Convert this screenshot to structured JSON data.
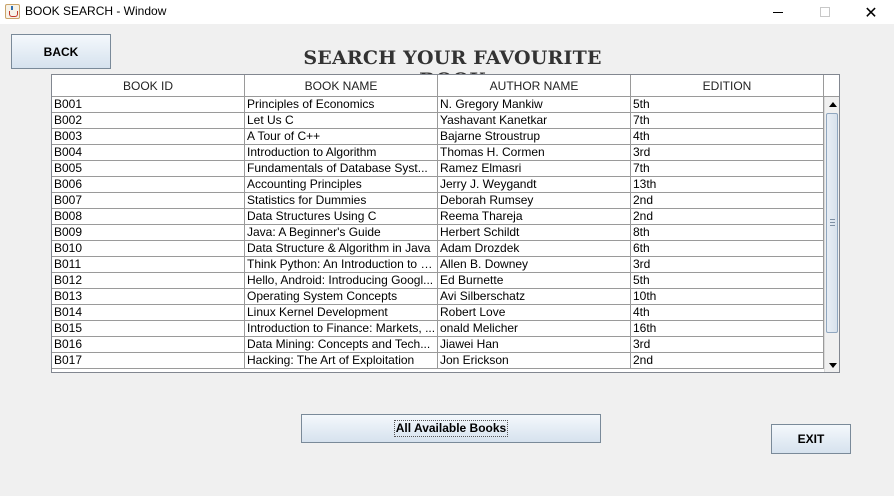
{
  "window": {
    "title": "BOOK SEARCH - Window",
    "close_glyph": "✕"
  },
  "header": {
    "back_label": "BACK",
    "title": "SEARCH YOUR FAVOURITE BOOK"
  },
  "table": {
    "columns": [
      "BOOK ID",
      "BOOK NAME",
      "AUTHOR NAME",
      "EDITION"
    ],
    "rows": [
      [
        "B001",
        "Principles of Economics",
        "N. Gregory Mankiw",
        "5th"
      ],
      [
        "B002",
        "Let Us C",
        "Yashavant Kanetkar",
        "7th"
      ],
      [
        "B003",
        "A Tour of C++",
        "Bajarne Stroustrup",
        "4th"
      ],
      [
        "B004",
        "Introduction to Algorithm",
        "Thomas H. Cormen",
        "3rd"
      ],
      [
        "B005",
        "Fundamentals of Database Syst...",
        "Ramez Elmasri",
        "7th"
      ],
      [
        "B006",
        "Accounting Principles",
        "Jerry J. Weygandt",
        "13th"
      ],
      [
        "B007",
        "Statistics for Dummies",
        "Deborah Rumsey",
        "2nd"
      ],
      [
        "B008",
        "Data Structures Using C",
        "Reema Thareja",
        "2nd"
      ],
      [
        "B009",
        "Java: A Beginner's Guide",
        "Herbert Schildt",
        "8th"
      ],
      [
        "B010",
        "Data Structure & Algorithm in Java",
        "Adam Drozdek",
        "6th"
      ],
      [
        "B011",
        "Think Python: An Introduction to S...",
        "Allen B. Downey",
        "3rd"
      ],
      [
        "B012",
        "Hello, Android: Introducing Googl...",
        "Ed Burnette",
        "5th"
      ],
      [
        "B013",
        "Operating System Concepts",
        "Avi Silberschatz",
        "10th"
      ],
      [
        "B014",
        "Linux Kernel Development",
        "Robert Love",
        "4th"
      ],
      [
        "B015",
        "Introduction to Finance: Markets, ...",
        "onald Melicher",
        "16th"
      ],
      [
        "B016",
        "Data Mining: Concepts and Tech...",
        "Jiawei Han",
        "3rd"
      ],
      [
        "B017",
        "Hacking: The Art of Exploitation",
        "Jon Erickson",
        "2nd"
      ]
    ]
  },
  "footer": {
    "all_books_label": "All Available Books",
    "exit_label": "EXIT"
  }
}
